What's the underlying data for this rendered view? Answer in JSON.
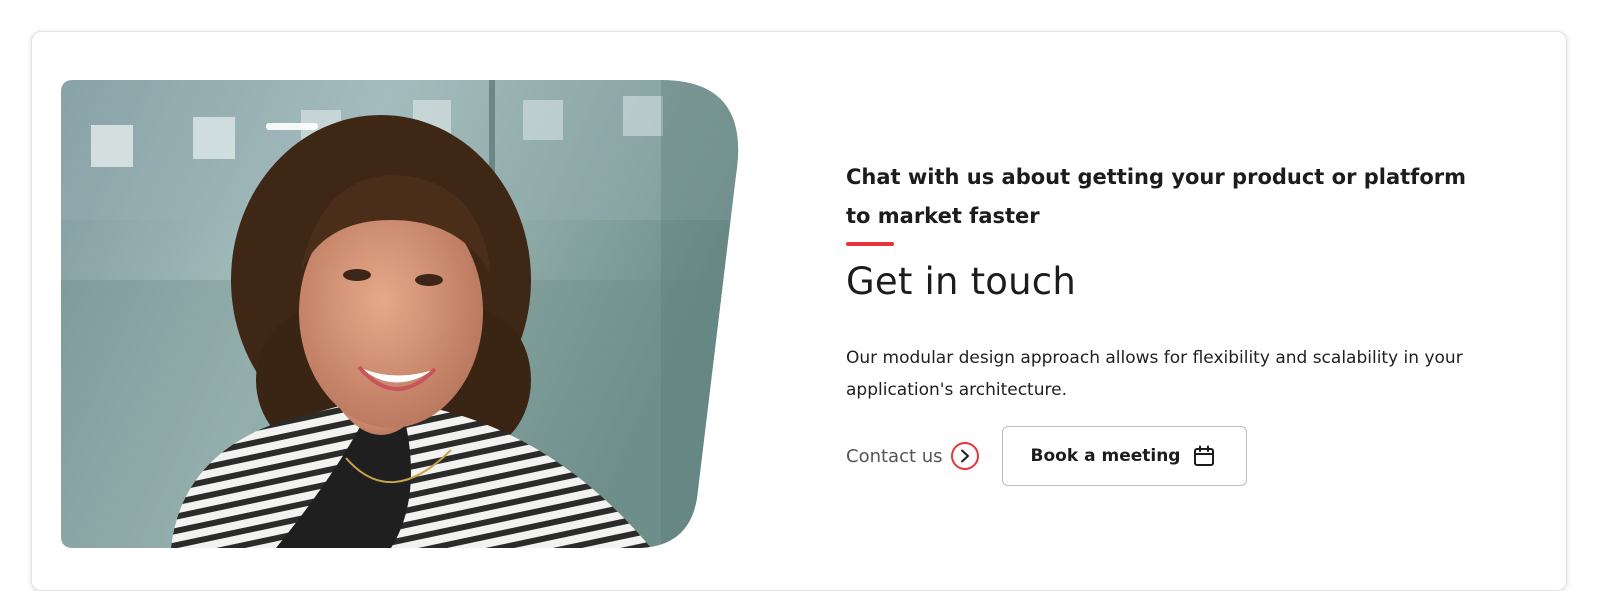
{
  "cta": {
    "eyebrow": "Chat with us about getting your product or platform to market faster",
    "heading": "Get in touch",
    "body": "Our modular design approach allows for flexibility and scalability in your application's architecture.",
    "contact_label": "Contact us",
    "book_label": "Book a meeting"
  },
  "icons": {
    "contact_arrow": "chevron-right-icon",
    "book": "calendar-icon"
  },
  "colors": {
    "accent": "#e5343b",
    "text": "#1c1c1c",
    "muted_link": "#555555",
    "button_border": "#bdbdbd"
  }
}
